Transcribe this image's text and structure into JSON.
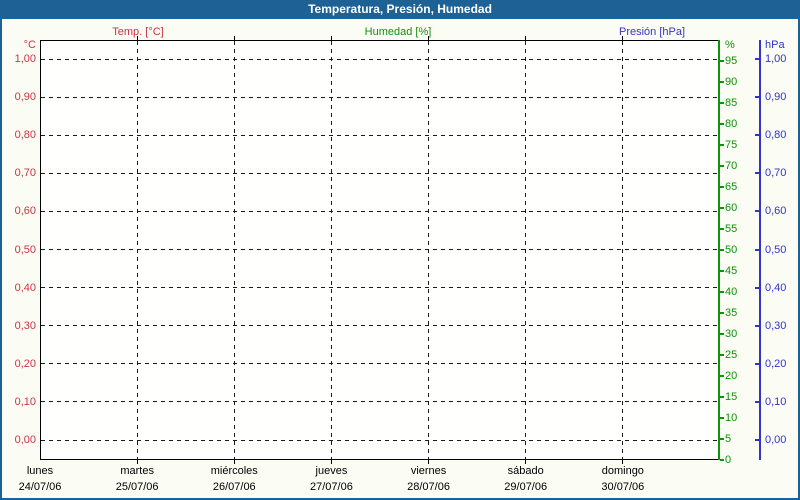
{
  "window": {
    "title": "Temperatura, Presión, Humedad"
  },
  "chart_data": {
    "type": "line",
    "title": "Temperatura, Presión, Humedad",
    "legend_position": "top",
    "grid": true,
    "series": [
      {
        "name": "Temp. [°C]",
        "color": "#cc3344",
        "axis": "left",
        "values": []
      },
      {
        "name": "Humedad [%]",
        "color": "#0d930d",
        "axis": "right_inner",
        "values": []
      },
      {
        "name": "Presión [hPa]",
        "color": "#3333cc",
        "axis": "right_outer",
        "values": []
      }
    ],
    "axes": {
      "left": {
        "header": "°C",
        "color": "#cc3344",
        "min": 0.0,
        "max": 1.0,
        "ticks": [
          {
            "v": 1.0,
            "label": "1,00"
          },
          {
            "v": 0.9,
            "label": "0,90"
          },
          {
            "v": 0.8,
            "label": "0,80"
          },
          {
            "v": 0.7,
            "label": "0,70"
          },
          {
            "v": 0.6,
            "label": "0,60"
          },
          {
            "v": 0.5,
            "label": "0,50"
          },
          {
            "v": 0.4,
            "label": "0,40"
          },
          {
            "v": 0.3,
            "label": "0,30"
          },
          {
            "v": 0.2,
            "label": "0,20"
          },
          {
            "v": 0.1,
            "label": "0,10"
          },
          {
            "v": 0.0,
            "label": "0,00"
          }
        ]
      },
      "right_inner": {
        "header": "%",
        "color": "#0d930d",
        "min": 0,
        "max": 100,
        "ticks": [
          {
            "v": 95,
            "label": "95"
          },
          {
            "v": 90,
            "label": "90"
          },
          {
            "v": 85,
            "label": "85"
          },
          {
            "v": 80,
            "label": "80"
          },
          {
            "v": 75,
            "label": "75"
          },
          {
            "v": 70,
            "label": "70"
          },
          {
            "v": 65,
            "label": "65"
          },
          {
            "v": 60,
            "label": "60"
          },
          {
            "v": 55,
            "label": "55"
          },
          {
            "v": 50,
            "label": "50"
          },
          {
            "v": 45,
            "label": "45"
          },
          {
            "v": 40,
            "label": "40"
          },
          {
            "v": 35,
            "label": "35"
          },
          {
            "v": 30,
            "label": "30"
          },
          {
            "v": 25,
            "label": "25"
          },
          {
            "v": 20,
            "label": "20"
          },
          {
            "v": 15,
            "label": "15"
          },
          {
            "v": 10,
            "label": "10"
          },
          {
            "v": 5,
            "label": "5"
          },
          {
            "v": 0,
            "label": "0"
          }
        ]
      },
      "right_outer": {
        "header": "hPa",
        "color": "#3333cc",
        "min": 0.0,
        "max": 1.0,
        "ticks": [
          {
            "v": 1.0,
            "label": "1,00"
          },
          {
            "v": 0.9,
            "label": "0,90"
          },
          {
            "v": 0.8,
            "label": "0,80"
          },
          {
            "v": 0.7,
            "label": "0,70"
          },
          {
            "v": 0.6,
            "label": "0,60"
          },
          {
            "v": 0.5,
            "label": "0,50"
          },
          {
            "v": 0.4,
            "label": "0,40"
          },
          {
            "v": 0.3,
            "label": "0,30"
          },
          {
            "v": 0.2,
            "label": "0,20"
          },
          {
            "v": 0.1,
            "label": "0,10"
          },
          {
            "v": 0.0,
            "label": "0,00"
          }
        ]
      }
    },
    "x_axis": {
      "days": [
        {
          "name": "lunes",
          "date": "24/07/06"
        },
        {
          "name": "martes",
          "date": "25/07/06"
        },
        {
          "name": "miércoles",
          "date": "26/07/06"
        },
        {
          "name": "jueves",
          "date": "27/07/06"
        },
        {
          "name": "viernes",
          "date": "28/07/06"
        },
        {
          "name": "sábado",
          "date": "29/07/06"
        },
        {
          "name": "domingo",
          "date": "30/07/06"
        }
      ]
    }
  }
}
